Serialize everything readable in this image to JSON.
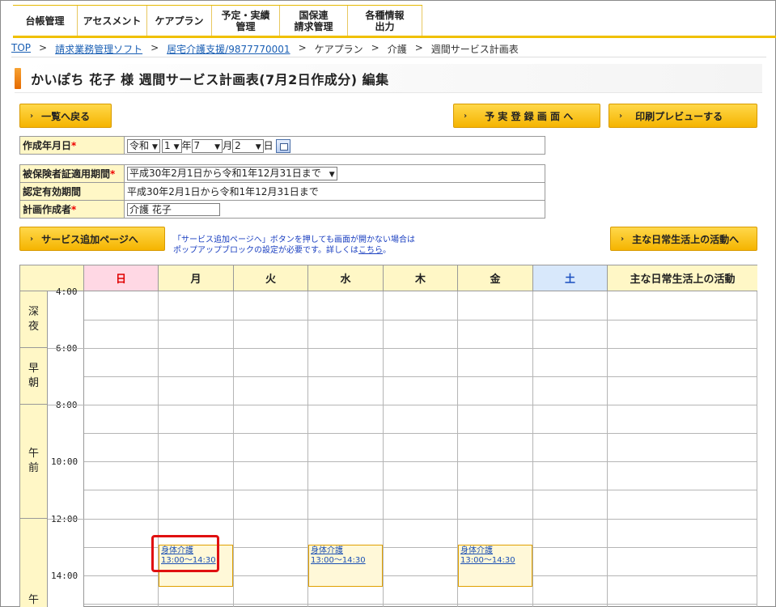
{
  "nav": {
    "items": [
      "台帳管理",
      "アセスメント",
      "ケアプラン",
      "予定・実績\n管理",
      "国保連\n請求管理",
      "各種情報\n出力"
    ]
  },
  "breadcrumb": {
    "top": "TOP",
    "sep": ">",
    "link1": "請求業務管理ソフト",
    "link2": "居宅介護支援/9877770001",
    "text1": "ケアプラン",
    "text2": "介護",
    "text3": "週間サービス計画表"
  },
  "title": "かいぽち 花子 様 週間サービス計画表(7月2日作成分) 編集",
  "buttons": {
    "back": "一覧へ戻る",
    "schedule": "予 実 登 録 画 面 へ",
    "print": "印刷プレビューする",
    "add_service": "サービス追加ページへ",
    "activities": "主な日常生活上の活動へ"
  },
  "form": {
    "created_label": "作成年月日",
    "required_mark": "*",
    "era": "令和",
    "year": "1",
    "year_suffix": "年",
    "month": "7",
    "month_suffix": "月",
    "day": "2",
    "day_suffix": "日",
    "insurance_period_label": "被保険者証適用期間",
    "insurance_period_value": "平成30年2月1日から令和1年12月31日まで",
    "cert_period_label": "認定有効期間",
    "cert_period_value": "平成30年2月1日から令和1年12月31日まで",
    "planner_label": "計画作成者",
    "planner_value": "介護 花子"
  },
  "notice": {
    "line1": "「サービス追加ページへ」ボタンを押しても画面が開かない場合は",
    "line2": "ポップアップブロックの設定が必要です。詳しくは",
    "link": "こちら",
    "end": "。"
  },
  "grid": {
    "days": [
      "日",
      "月",
      "火",
      "水",
      "木",
      "金",
      "土"
    ],
    "activities_header": "主な日常生活上の活動",
    "periods": [
      "深\n夜",
      "早\n朝",
      "午\n前",
      "午\n後"
    ],
    "times": [
      "4:00",
      "6:00",
      "8:00",
      "10:00",
      "12:00",
      "14:00"
    ],
    "services": [
      {
        "name": "身体介護",
        "time": "13:00〜14:30"
      },
      {
        "name": "身体介護",
        "time": "13:00〜14:30"
      },
      {
        "name": "身体介護",
        "time": "13:00〜14:30"
      }
    ]
  },
  "colors": {
    "sunday_header": "#ffd8e4",
    "saturday_header": "#d8e8fb",
    "label_bg": "#fff7c6",
    "accent": "#f5b400",
    "sunday_text": "#e00000",
    "saturday_text": "#1a4fc0"
  }
}
